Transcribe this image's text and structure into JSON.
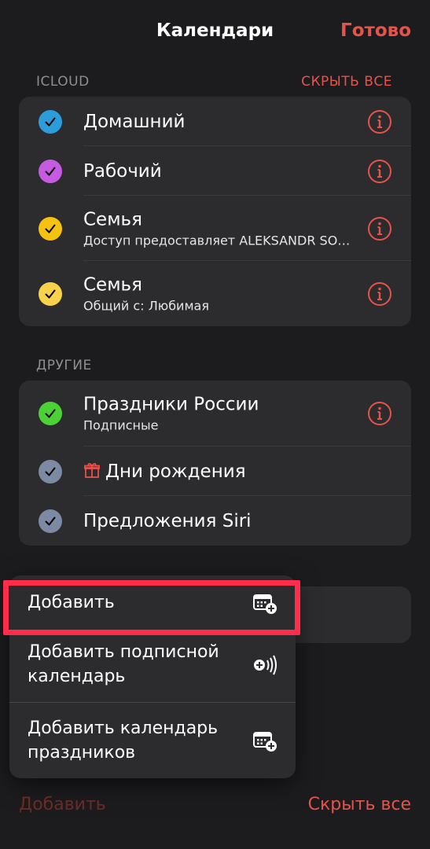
{
  "nav": {
    "title": "Календари",
    "done": "Готово"
  },
  "icloud": {
    "header": "ICLOUD",
    "action": "СКРЫТЬ ВСЕ",
    "items": [
      {
        "title": "Домашний",
        "subtitle": "",
        "color": "#2d9cdb"
      },
      {
        "title": "Рабочий",
        "subtitle": "",
        "color": "#c45be0"
      },
      {
        "title": "Семья",
        "subtitle": "Доступ предоставляет ALEKSANDR SO…",
        "color": "#f5c211"
      },
      {
        "title": "Семья",
        "subtitle": "Общий с: Любимая",
        "color": "#f8d24a"
      }
    ]
  },
  "other": {
    "header": "ДРУГИЕ",
    "items": [
      {
        "title": "Праздники России",
        "subtitle": "Подписные",
        "color": "#4cd137"
      },
      {
        "title": "Дни рождения",
        "subtitle": "",
        "color": "#7d8aa3"
      },
      {
        "title": "Предложения Siri",
        "subtitle": "",
        "color": "#7d8aa3"
      }
    ]
  },
  "menu": {
    "items": [
      {
        "label": "Добавить",
        "icon": "calendar-add-icon"
      },
      {
        "label": "Добавить подписной календарь",
        "icon": "subscribe-broadcast-icon"
      },
      {
        "label": "Добавить календарь праздников",
        "icon": "calendar-add-icon"
      }
    ]
  },
  "toolbar": {
    "add": "Добавить",
    "hide_all": "Скрыть все"
  },
  "colors": {
    "accent": "#e5534b",
    "highlight": "#ff2d4b"
  }
}
